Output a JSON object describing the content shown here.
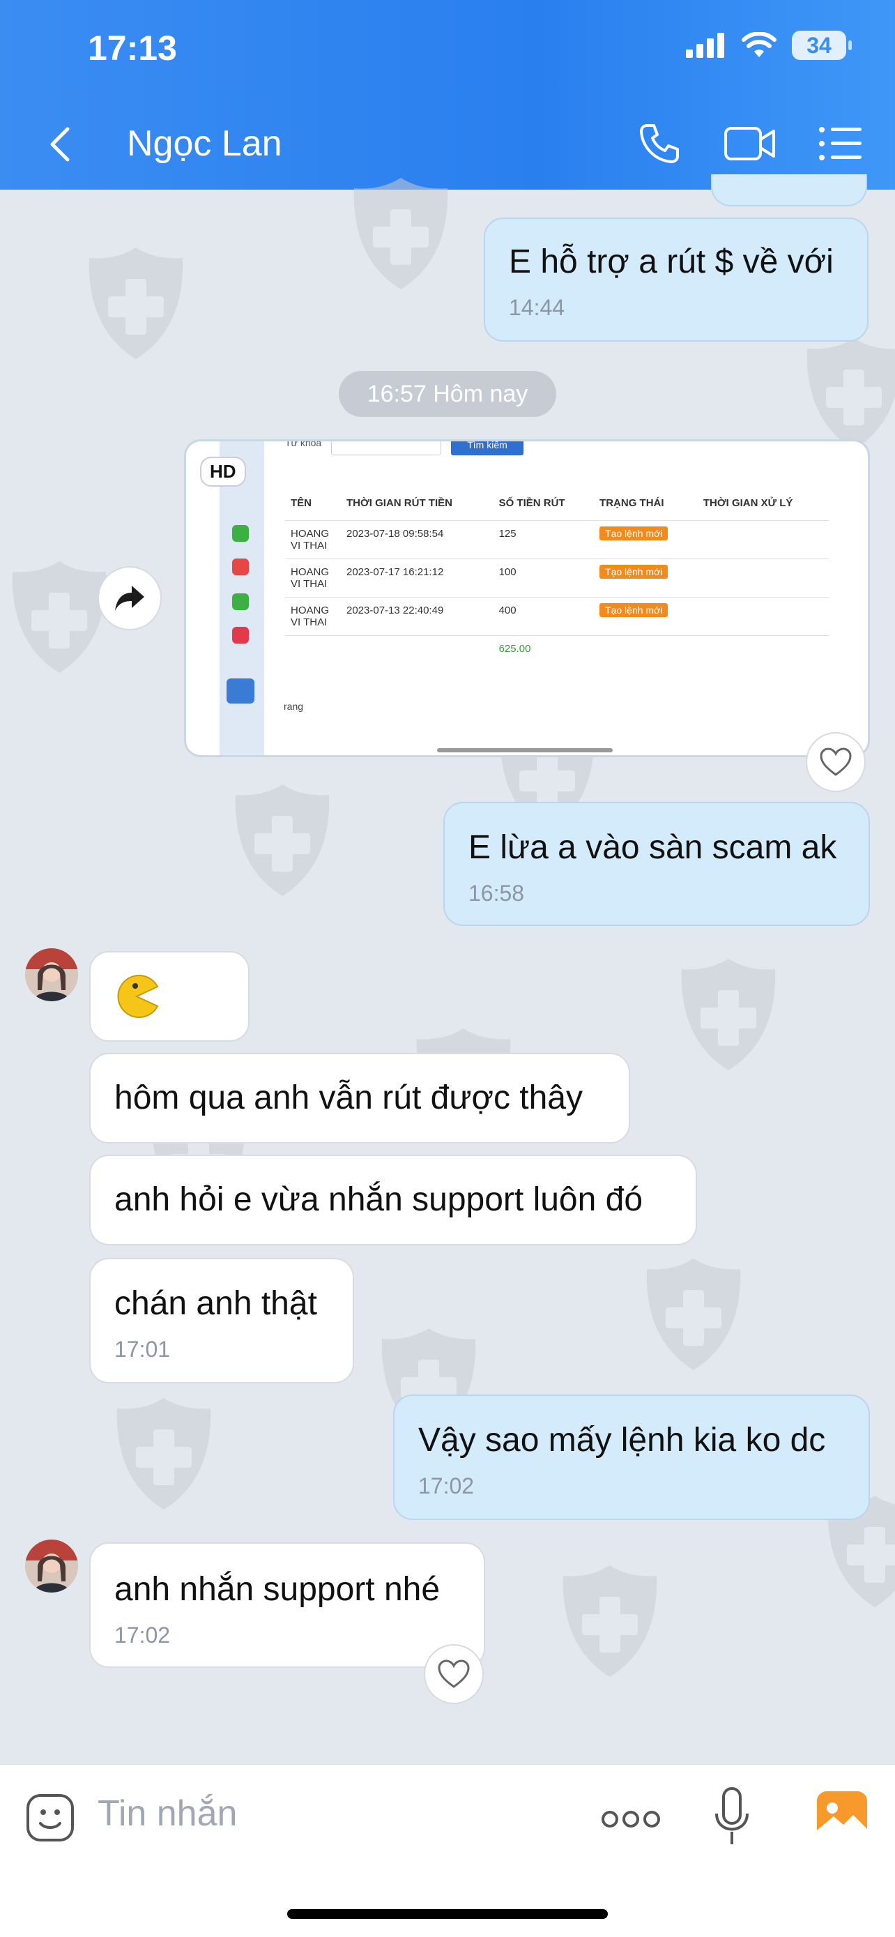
{
  "status_bar": {
    "time": "17:13",
    "battery": "34"
  },
  "nav": {
    "title": "Ngọc Lan"
  },
  "date_separator": "16:57 Hôm nay",
  "image_message": {
    "hd_label": "HD",
    "keyword_label": "Từ khoá",
    "search_button": "Tìm kiếm",
    "columns": [
      "TÊN",
      "THỜI GIAN RÚT TIỀN",
      "SỐ TIỀN RÚT",
      "TRẠNG THÁI",
      "THỜI GIAN XỬ LÝ"
    ],
    "rows": [
      {
        "name": "HOANG VI THAI",
        "time": "2023-07-18 09:58:54",
        "amount": "125",
        "status": "Tạo lệnh mới"
      },
      {
        "name": "HOANG VI THAI",
        "time": "2023-07-17 16:21:12",
        "amount": "100",
        "status": "Tạo lệnh mới"
      },
      {
        "name": "HOANG VI THAI",
        "time": "2023-07-13 22:40:49",
        "amount": "400",
        "status": "Tạo lệnh mới"
      }
    ],
    "total": "625.00",
    "page_label": "rang"
  },
  "messages": [
    {
      "dir": "out",
      "text": "E hỗ trợ a rút $ về với",
      "time": "14:44"
    },
    {
      "dir": "out",
      "text": "E lừa a vào sàn scam ak",
      "time": "16:58"
    },
    {
      "dir": "in",
      "text": "",
      "emoji": "pacman"
    },
    {
      "dir": "in",
      "text": "hôm qua anh vẫn rút được thây"
    },
    {
      "dir": "in",
      "text": "anh hỏi e vừa nhắn support luôn đó"
    },
    {
      "dir": "in",
      "text": "chán anh thật",
      "time": "17:01"
    },
    {
      "dir": "out",
      "text": "Vậy sao mấy lệnh kia ko dc",
      "time": "17:02"
    },
    {
      "dir": "in",
      "text": "anh nhắn support nhé",
      "time": "17:02"
    }
  ],
  "input": {
    "placeholder": "Tin nhắn"
  },
  "colors": {
    "header": "#2a7fef",
    "outgoing": "#d4ebfb",
    "incoming": "#ffffff",
    "badge": "#f28b1b"
  }
}
